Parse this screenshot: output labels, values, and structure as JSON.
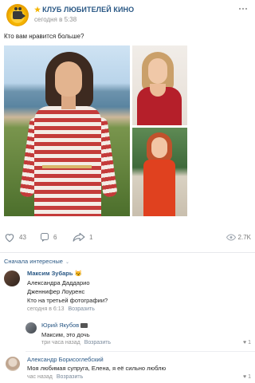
{
  "post": {
    "group_name": "КЛУБ ЛЮБИТЕЛЕЙ КИНО",
    "time": "сегодня в 5:38",
    "text": "Кто вам нравится больше?",
    "likes": "43",
    "comments": "6",
    "shares": "1",
    "views": "2.7K"
  },
  "section": {
    "label": "Сначала интересные"
  },
  "comments": [
    {
      "author": "Максим Зубарь",
      "lines": [
        "Александра Даддарио",
        "Дженнифер Лоуренс",
        "Кто на третьей фотографии?"
      ],
      "time": "сегодня в 6:13",
      "reply": "Возразить"
    },
    {
      "author": "Юрий Якубов",
      "text": "Максим, это дочь",
      "time": "три часа назад",
      "reply": "Возразить",
      "likes": "1"
    },
    {
      "author": "Александр Борисоглебский",
      "text": "Моя любимая супруга, Елена, я её сильно люблю",
      "time": "час назад",
      "reply": "Возразить",
      "likes": "1"
    }
  ],
  "colors": {
    "link": "#2a5885",
    "muted": "#939393",
    "accent_star": "#f4b400"
  },
  "icons": [
    "heart-icon",
    "comment-icon",
    "share-icon",
    "eye-icon",
    "chevron-down-icon"
  ]
}
